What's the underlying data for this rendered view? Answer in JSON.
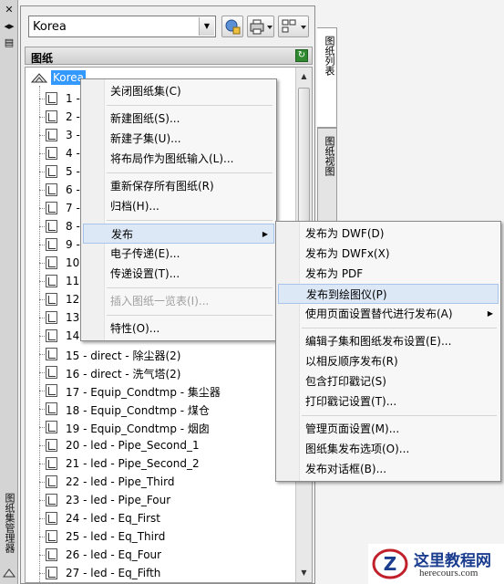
{
  "strip": {
    "close": "✕",
    "pin": "◂▸",
    "props": "▤",
    "title": "图纸集管理器"
  },
  "toolbar": {
    "combo_value": "Korea"
  },
  "section": {
    "title": "图纸",
    "root": "Korea"
  },
  "sheets": [
    "1 - ",
    "2 - ",
    "3 - ",
    "4 - ",
    "5 - ",
    "6 - ",
    "7 - ",
    "8 - ",
    "9 - ",
    "10",
    "11",
    "12",
    "13",
    "14",
    "15 - direct - 除尘器(2)",
    "16 - direct - 洗气塔(2)",
    "17 - Equip_Condtmp - 集尘器",
    "18 - Equip_Condtmp - 煤仓",
    "19 - Equip_Condtmp - 烟囱",
    "20 - led - Pipe_Second_1",
    "21 - led - Pipe_Second_2",
    "22 - led - Pipe_Third",
    "23 - led - Pipe_Four",
    "24 - led - Eq_First",
    "25 - led - Eq_Third",
    "26 - led - Eq_Four",
    "27 - led - Eq_Fifth"
  ],
  "tabs": {
    "list": "图纸列表",
    "view": "图纸视图"
  },
  "context_menu": {
    "items": [
      "关闭图纸集(C)",
      "新建图纸(S)...",
      "新建子集(U)...",
      "将布局作为图纸输入(L)...",
      "重新保存所有图纸(R)",
      "归档(H)...",
      "发布",
      "电子传递(E)...",
      "传递设置(T)...",
      "插入图纸一览表(I)...",
      "特性(O)..."
    ]
  },
  "publish_menu": {
    "items": [
      "发布为 DWF(D)",
      "发布为 DWFx(X)",
      "发布为 PDF",
      "发布到绘图仪(P)",
      "使用页面设置替代进行发布(A)",
      "编辑子集和图纸发布设置(E)...",
      "以相反顺序发布(R)",
      "包含打印戳记(S)",
      "打印戳记设置(T)...",
      "管理页面设置(M)...",
      "图纸集发布选项(O)...",
      "发布对话框(B)..."
    ]
  },
  "watermark": {
    "title": "这里教程网",
    "url": "herecours.com"
  }
}
